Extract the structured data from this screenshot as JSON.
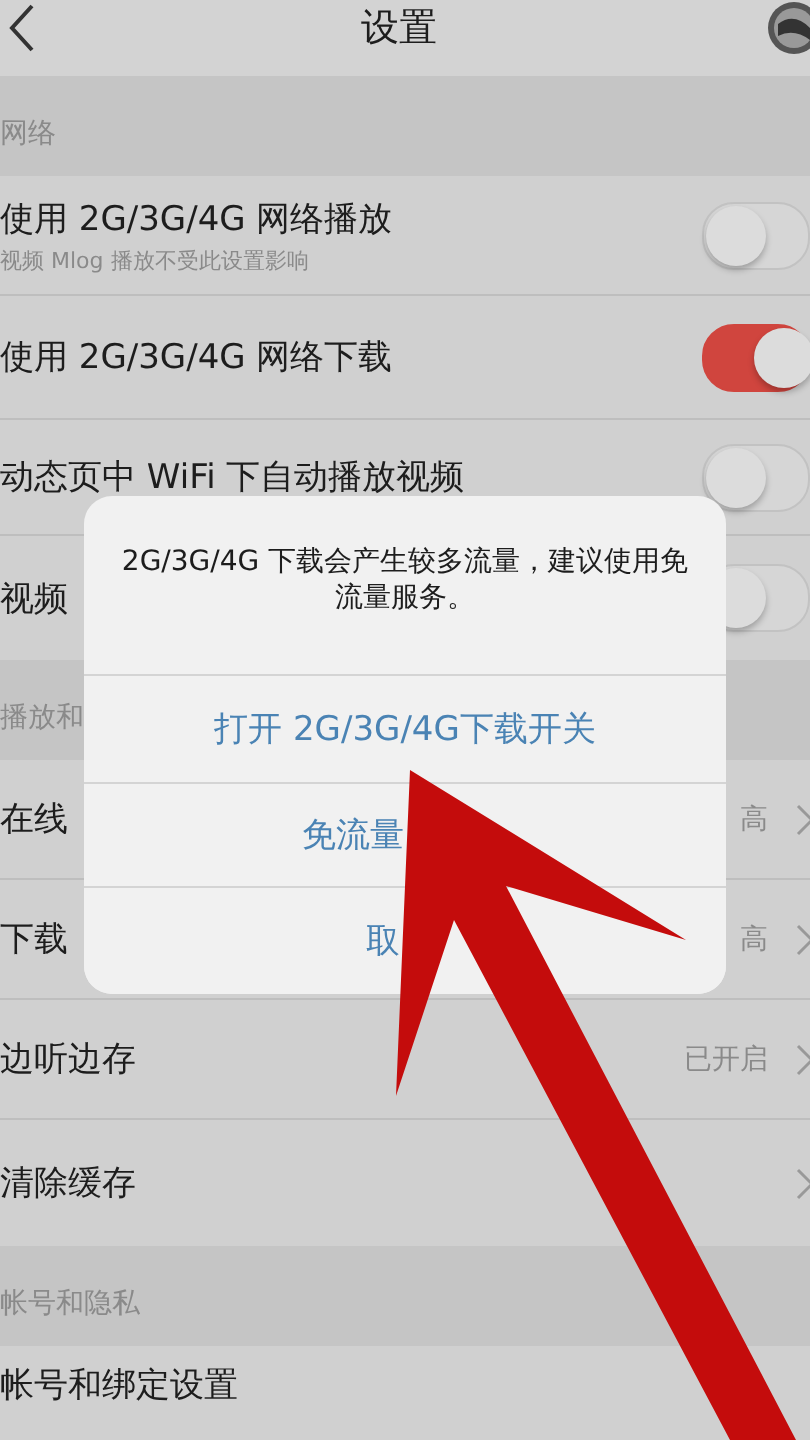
{
  "nav": {
    "title": "设置"
  },
  "sections": [
    {
      "header": "网络",
      "rows": [
        {
          "kind": "toggle",
          "label": "使用 2G/3G/4G 网络播放",
          "sublabel": "视频 Mlog 播放不受此设置影响",
          "on": false
        },
        {
          "kind": "toggle",
          "label": "使用 2G/3G/4G 网络下载",
          "on": true
        },
        {
          "kind": "toggle",
          "label": "动态页中 WiFi 下自动播放视频",
          "on": false
        },
        {
          "kind": "toggle",
          "label": "视频",
          "on": false
        }
      ]
    },
    {
      "header": "播放和",
      "rows": [
        {
          "kind": "link",
          "label": "在线",
          "value": "高"
        },
        {
          "kind": "link",
          "label": "下载",
          "value": "高"
        },
        {
          "kind": "link",
          "label": "边听边存",
          "value": "已开启"
        },
        {
          "kind": "link",
          "label": "清除缓存"
        }
      ]
    },
    {
      "header": "帐号和隐私",
      "rows": [
        {
          "kind": "plain",
          "label": "帐号和绑定设置"
        }
      ]
    }
  ],
  "dialog": {
    "message": "2G/3G/4G 下载会产生较多流量，建议使用免流量服务。",
    "buttons": [
      "打开 2G/3G/4G下载开关",
      "免流量",
      "取"
    ]
  }
}
